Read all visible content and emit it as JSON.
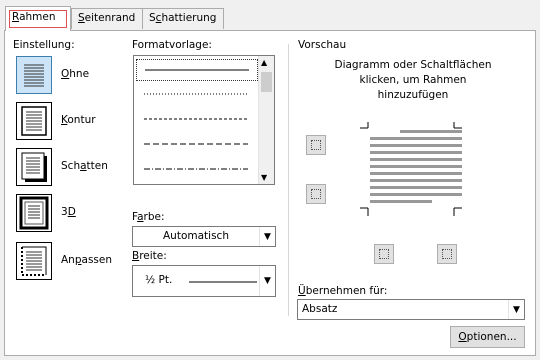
{
  "tabs": [
    {
      "label": "Rahmen",
      "access": "R",
      "rest": "ahmen"
    },
    {
      "label": "Seitenrand",
      "access": "S",
      "rest": "eitenrand"
    },
    {
      "label": "Schattierung",
      "access": "c",
      "pre": "S",
      "rest": "hattierung"
    }
  ],
  "settings": {
    "heading": "Einstellung:",
    "items": [
      {
        "label": "Ohne",
        "access": "O",
        "rest": "hne",
        "selected": true
      },
      {
        "label": "Kontur",
        "access": "K",
        "rest": "ontur"
      },
      {
        "label": "Schatten",
        "pre": "Sch",
        "access": "a",
        "rest": "tten"
      },
      {
        "label": "3D",
        "pre": "3",
        "access": "D",
        "rest": ""
      },
      {
        "label": "Anpassen",
        "pre": "An",
        "access": "p",
        "rest": "assen"
      }
    ]
  },
  "style": {
    "heading": "Formatvorlage:",
    "line_styles": [
      "solid",
      "dotted",
      "dashed-small",
      "dashed",
      "dash-dot"
    ],
    "color_label": {
      "pre": "F",
      "access": "a",
      "rest": "rbe:"
    },
    "color_value": "Automatisch",
    "width_label": {
      "pre": "",
      "access": "B",
      "rest": "reite:"
    },
    "width_value": "½ Pt."
  },
  "preview": {
    "heading": "Vorschau",
    "hint_line1": "Diagramm oder Schaltflächen",
    "hint_line2": "klicken, um Rahmen",
    "hint_line3": "hinzuzufügen"
  },
  "apply_to": {
    "label": {
      "pre": "",
      "access": "Ü",
      "rest": "bernehmen für:"
    },
    "value": "Absatz"
  },
  "options_button": {
    "pre": "",
    "access": "O",
    "rest": "ptionen..."
  },
  "colors": {
    "selected_bg": "#cce4f7",
    "selected_border": "#3c7fb1",
    "focus": "#e05050"
  }
}
